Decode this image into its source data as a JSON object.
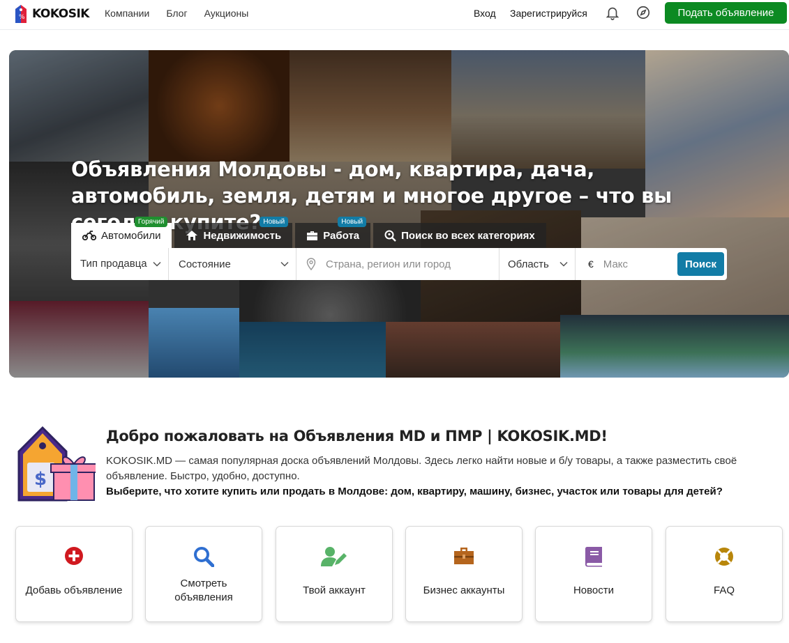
{
  "header": {
    "logo_text": "KOKOSIK",
    "nav": [
      "Компании",
      "Блог",
      "Аукционы"
    ],
    "login": "Вход",
    "register": "Зарегистрируйся",
    "post_button": "Подать объявление"
  },
  "hero": {
    "title": "Объявления Молдовы - дом, квартира, дача, автомобиль, земля, детям и многое другое – что вы сегодня купите?",
    "tabs": [
      {
        "label": "Автомобили",
        "badge": "Горячий",
        "icon": "motorcycle-icon"
      },
      {
        "label": "Недвижимость",
        "badge": "Новый",
        "icon": "home-icon"
      },
      {
        "label": "Работа",
        "badge": "Новый",
        "icon": "briefcase-icon"
      },
      {
        "label": "Поиск во всех категориях",
        "badge": "",
        "icon": "search-location-icon"
      }
    ],
    "search": {
      "seller_type": "Тип продавца",
      "condition": "Состояние",
      "location_placeholder": "Страна, регион или город",
      "region": "Область",
      "currency": "€",
      "max_placeholder": "Макс",
      "button": "Поиск"
    }
  },
  "welcome": {
    "title": "Добро пожаловать на Объявления MD и ПМР | KOKOSIK.MD!",
    "description": "KOKOSIK.MD — самая популярная доска объявлений Молдовы. Здесь легко найти новые и б/у товары, а также разместить своё объявление. Быстро, удобно, доступно.",
    "call_to_action": "Выберите, что хотите купить или продать в Молдове: дом, квартиру, машину, бизнес, участок или товары для детей?"
  },
  "cards": [
    {
      "label": "Добавь объявление",
      "icon": "plus-circle-icon",
      "color": "#d0191f"
    },
    {
      "label": "Смотреть объявления",
      "icon": "search-icon",
      "color": "#2f6fd1"
    },
    {
      "label": "Твой аккаунт",
      "icon": "user-edit-icon",
      "color": "#58b368"
    },
    {
      "label": "Бизнес аккаунты",
      "icon": "briefcase-icon",
      "color": "#b5651d"
    },
    {
      "label": "Новости",
      "icon": "book-icon",
      "color": "#8a5aa6"
    },
    {
      "label": "FAQ",
      "icon": "life-ring-icon",
      "color": "#b8860b"
    }
  ],
  "colors": {
    "primary_green": "#0c8a22",
    "search_blue": "#127ca6",
    "badge_green": "#1f8f2f"
  }
}
